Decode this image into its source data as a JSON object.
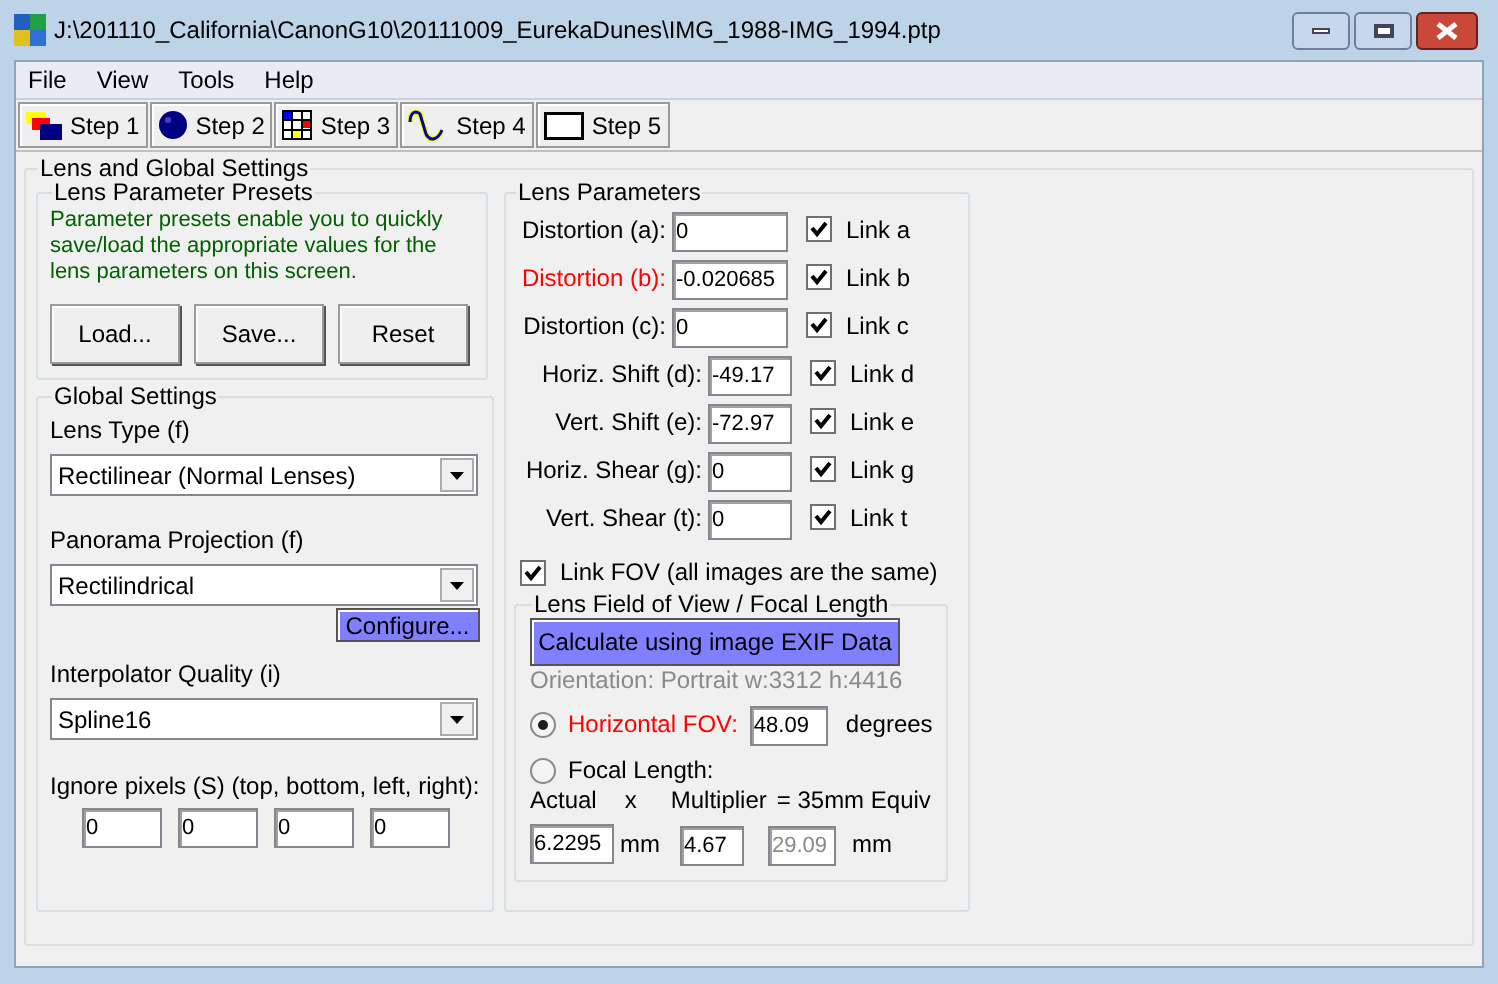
{
  "window": {
    "title": "J:\\201110_California\\CanonG10\\20111009_EurekaDunes\\IMG_1988-IMG_1994.ptp"
  },
  "menu": [
    "File",
    "View",
    "Tools",
    "Help"
  ],
  "toolbar": [
    {
      "label": "Step 1",
      "kind": "layers"
    },
    {
      "label": "Step 2",
      "kind": "ball"
    },
    {
      "label": "Step 3",
      "kind": "grid"
    },
    {
      "label": "Step 4",
      "kind": "wave"
    },
    {
      "label": "Step 5",
      "kind": "frame"
    }
  ],
  "main_group": {
    "title": "Lens and Global Settings"
  },
  "presets": {
    "title": "Lens Parameter Presets",
    "note": "Parameter presets enable you to quickly save/load the appropriate values for the lens parameters on this screen.",
    "buttons": [
      "Load...",
      "Save...",
      "Reset"
    ]
  },
  "global_settings": {
    "title": "Global Settings",
    "lens_type": {
      "label": "Lens Type (f)",
      "value": "Rectilinear (Normal Lenses)"
    },
    "projection": {
      "label": "Panorama Projection (f)",
      "value": "Rectilindrical",
      "button": "Configure..."
    },
    "interpolator": {
      "label": "Interpolator Quality (i)",
      "value": "Spline16"
    },
    "ignore_pixels": {
      "label": "Ignore pixels (S) (top, bottom, left, right):",
      "values": [
        "0",
        "0",
        "0",
        "0"
      ]
    }
  },
  "lens_parameters": {
    "title": "Lens Parameters",
    "rows": [
      {
        "label": "Distortion (a):",
        "value": "0",
        "highlighted": false,
        "kind": "wide",
        "link": "Link a",
        "checked": true
      },
      {
        "label": "Distortion (b):",
        "value": "-0.020685",
        "highlighted": true,
        "kind": "wide",
        "link": "Link b",
        "checked": true
      },
      {
        "label": "Distortion (c):",
        "value": "0",
        "highlighted": false,
        "kind": "wide",
        "link": "Link c",
        "checked": true
      },
      {
        "label": "Horiz. Shift (d):",
        "value": "-49.17",
        "highlighted": false,
        "kind": "narrow",
        "link": "Link d",
        "checked": true
      },
      {
        "label": "Vert. Shift (e):",
        "value": "-72.97",
        "highlighted": false,
        "kind": "narrow",
        "link": "Link e",
        "checked": true
      },
      {
        "label": "Horiz. Shear (g):",
        "value": "0",
        "highlighted": false,
        "kind": "narrow",
        "link": "Link g",
        "checked": true
      },
      {
        "label": "Vert. Shear (t):",
        "value": "0",
        "highlighted": false,
        "kind": "narrow",
        "link": "Link t",
        "checked": true
      }
    ],
    "link_fov": {
      "label": "Link FOV (all images are the same)",
      "checked": true
    }
  },
  "fov": {
    "title": "Lens Field of View / Focal Length",
    "button": "Calculate using image EXIF Data",
    "orientation": "Orientation: Portrait w:3312 h:4416",
    "horizontal": {
      "label": "Horizontal FOV:",
      "selected": true,
      "highlighted": true,
      "value": "48.09",
      "unit": "degrees"
    },
    "focal": {
      "label": "Focal Length:",
      "selected": false,
      "highlighted": false
    },
    "headers": [
      "Actual",
      "x",
      "Multiplier",
      "= 35mm Equiv"
    ],
    "actual": {
      "value": "6.2295",
      "unit": "mm"
    },
    "multiplier": {
      "value": "4.67"
    },
    "equiv": {
      "value": "29.09",
      "unit": "mm",
      "disabled": true
    }
  }
}
